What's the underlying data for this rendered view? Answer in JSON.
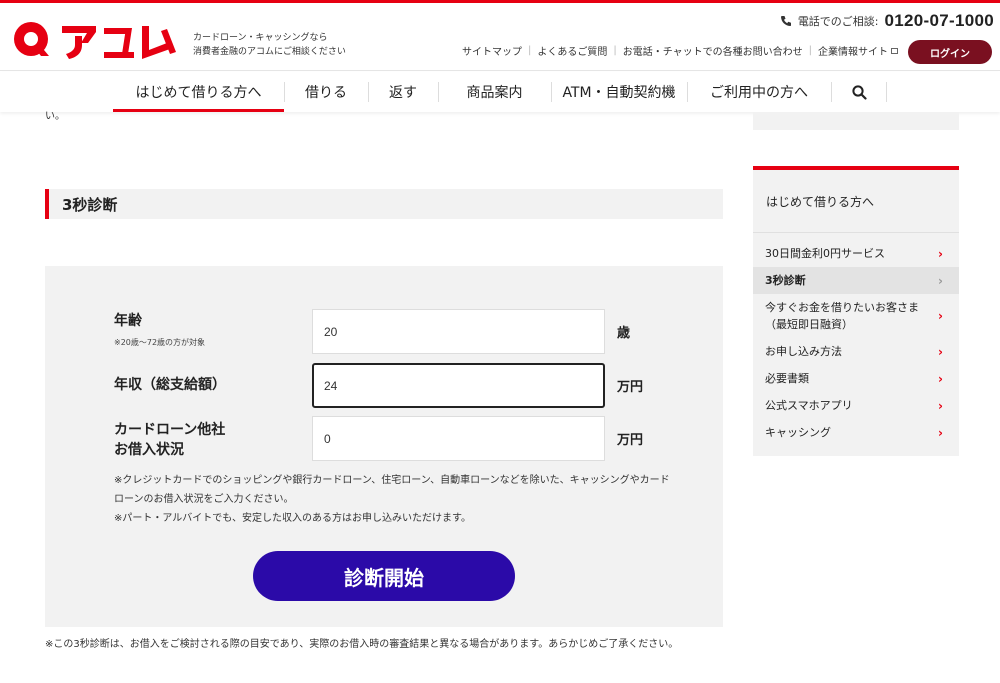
{
  "header": {
    "logo_text": "アコム",
    "tagline_line1": "カードローン・キャッシングなら",
    "tagline_line2": "消費者金融のアコムにご相談ください",
    "phone_label": "電話でのご相談:",
    "phone_number": "0120-07-1000",
    "subnav": [
      "サイトマップ",
      "よくあるご質問",
      "お電話・チャットでの各種お問い合わせ",
      "企業情報サイト"
    ],
    "login_label": "ログイン"
  },
  "nav": {
    "items": [
      {
        "label": "はじめて借りる方へ",
        "active": true
      },
      {
        "label": "借りる"
      },
      {
        "label": "返す"
      },
      {
        "label": "商品案内"
      },
      {
        "label": "ATM・自動契約機"
      },
      {
        "label": "ご利用中の方へ"
      }
    ],
    "search_icon": "search-icon"
  },
  "cut_text": "い。",
  "section": {
    "title": "3秒診断"
  },
  "form": {
    "age": {
      "label": "年齢",
      "note": "※20歳〜72歳の方が対象",
      "value": "20",
      "unit": "歳"
    },
    "income": {
      "label": "年収（総支給額）",
      "value": "24",
      "unit": "万円"
    },
    "other_loans": {
      "label_line1": "カードローン他社",
      "label_line2": "お借入状況",
      "value": "0",
      "unit": "万円"
    },
    "notes": [
      "※クレジットカードでのショッピングや銀行カードローン、住宅ローン、自動車ローンなどを除いた、キャッシングやカードローンのお借入状況をご入力ください。",
      "※パート・アルバイトでも、安定した収入のある方はお申し込みいただけます。"
    ],
    "submit_label": "診断開始"
  },
  "disclaimer": "※この3秒診断は、お借入をご検討される際の目安であり、実際のお借入時の審査結果と異なる場合があります。あらかじめご了承ください。",
  "sidebar": {
    "heading": "はじめて借りる方へ",
    "items": [
      {
        "label": "30日間金利0円サービス"
      },
      {
        "label": "3秒診断",
        "current": true
      },
      {
        "label": "今すぐお金を借りたいお客さま（最短即日融資）"
      },
      {
        "label": "お申し込み方法"
      },
      {
        "label": "必要書類"
      },
      {
        "label": "公式スマホアプリ"
      },
      {
        "label": "キャッシング"
      }
    ]
  },
  "colors": {
    "brand_red": "#e60012",
    "login_bg": "#7a1020",
    "cta_bg": "#2b0aa8"
  }
}
